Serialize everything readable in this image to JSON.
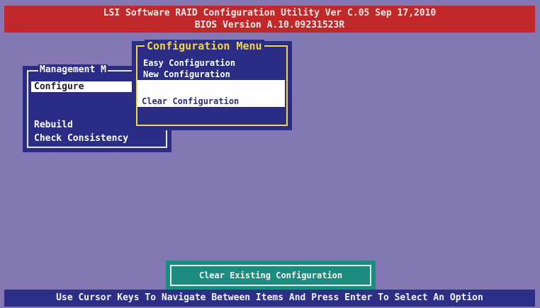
{
  "header": {
    "line1": "LSI Software RAID Configuration Utility Ver C.05 Sep 17,2010",
    "line2": "BIOS Version  A.10.09231523R"
  },
  "management_menu": {
    "title": "Management M",
    "items": [
      "Configure",
      "Rebuild",
      "Check Consistency"
    ],
    "selected": "Configure"
  },
  "configuration_menu": {
    "title": "Configuration Menu",
    "items": [
      "Easy Configuration",
      "New Configuration",
      "Clear Configuration"
    ],
    "selected": "Clear Configuration"
  },
  "status": {
    "text": "Clear Existing Configuration"
  },
  "footer": {
    "text": "Use Cursor Keys To Navigate Between Items And Press Enter To Select An Option"
  },
  "colors": {
    "background": "#8478b4",
    "header": "#c0282a",
    "menu": "#2a2c86",
    "menu_title": "#f3d54a",
    "status_box": "#1c8c80"
  }
}
